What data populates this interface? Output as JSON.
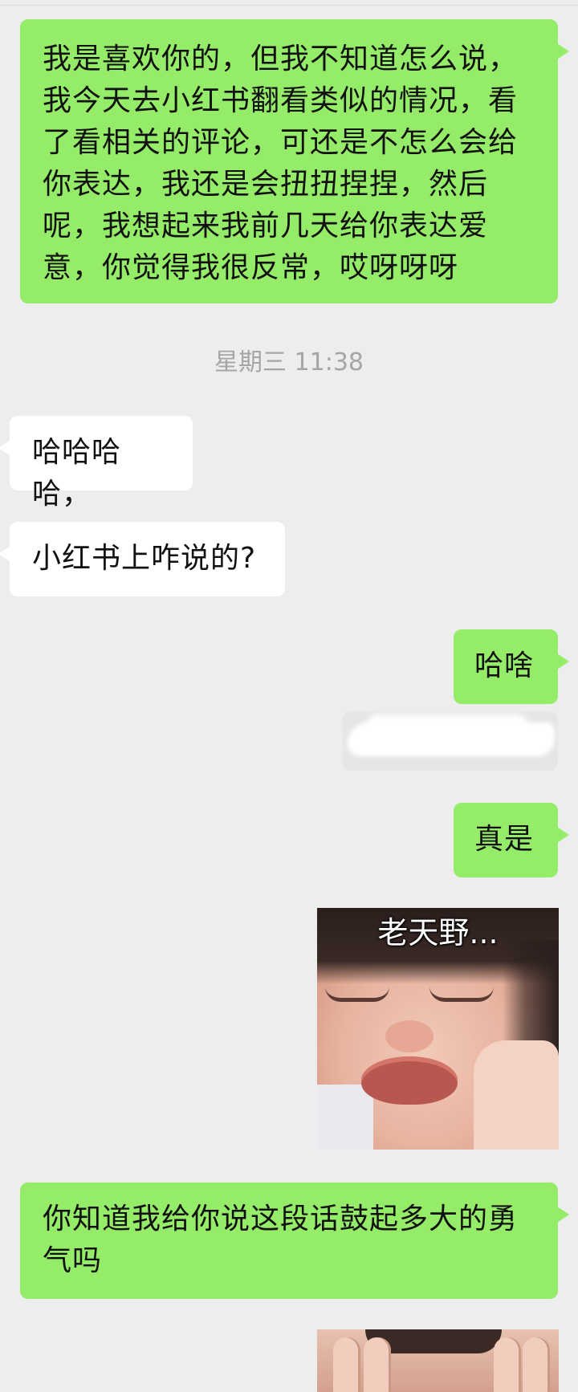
{
  "messages": [
    {
      "side": "me",
      "lines": [
        "我是喜欢你的，但我不知道怎么说，",
        "我今天去小红书翻看类似的情况，看",
        "了看相关的评论，可还是不怎么会给",
        "你表达，我还是会扭扭捏捏，然后",
        "呢，我想起来我前几天给你表达爱",
        "意，你觉得我很反常，哎呀呀呀"
      ]
    },
    {
      "side": "timestamp",
      "text": "星期三 11:38"
    },
    {
      "side": "other",
      "text": "哈哈哈哈，"
    },
    {
      "side": "other",
      "text": "小红书上咋说的?"
    },
    {
      "side": "me",
      "text": "哈啥"
    },
    {
      "side": "me",
      "text": "真是"
    },
    {
      "side": "me",
      "sticker_caption": "老天野..."
    },
    {
      "side": "me",
      "lines": [
        "你知道我给你说这段话鼓起多大的勇",
        "气吗"
      ]
    }
  ],
  "colors": {
    "background": "#ededed",
    "sent_bubble": "#95ec69",
    "received_bubble": "#ffffff",
    "timestamp_text": "#a5a5a5"
  }
}
